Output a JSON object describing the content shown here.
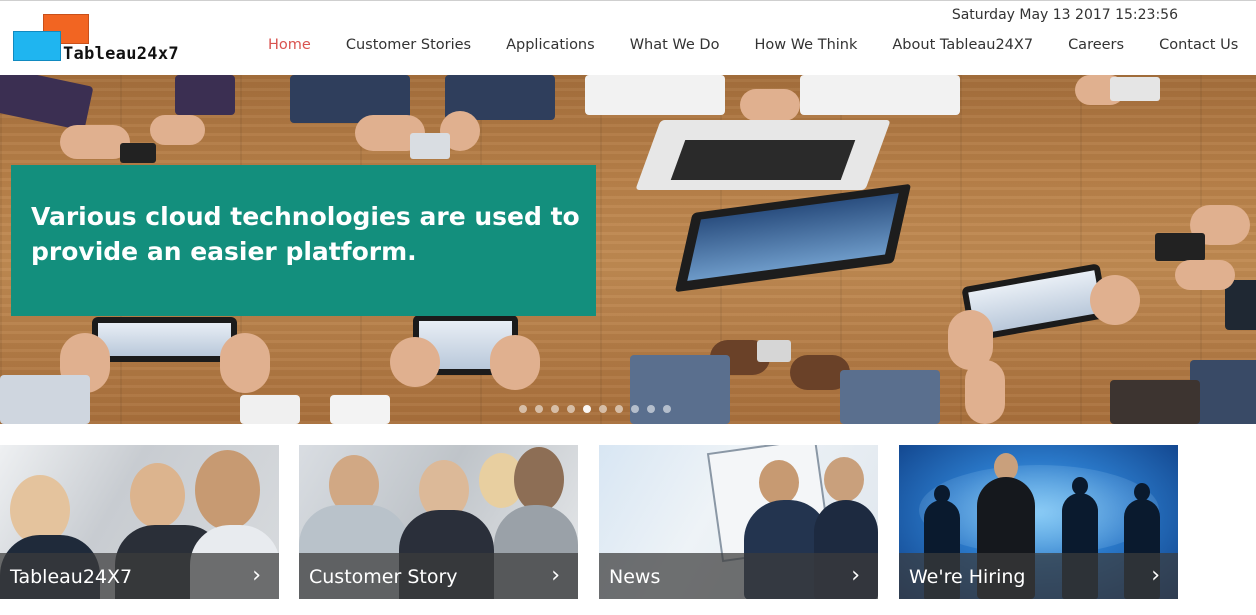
{
  "header": {
    "datetime": "Saturday May 13 2017 15:23:56",
    "logo_text": "Tableau24x7",
    "colors": {
      "logo_orange": "#f26522",
      "logo_blue": "#1fb5f0",
      "nav_active": "#d9534f"
    }
  },
  "nav": {
    "items": [
      {
        "label": "Home",
        "active": true
      },
      {
        "label": "Customer Stories",
        "active": false
      },
      {
        "label": "Applications",
        "active": false
      },
      {
        "label": "What We Do",
        "active": false
      },
      {
        "label": "How We Think",
        "active": false
      },
      {
        "label": "About Tableau24X7",
        "active": false
      },
      {
        "label": "Careers",
        "active": false
      },
      {
        "label": "Contact Us",
        "active": false
      }
    ]
  },
  "hero": {
    "caption": "Various cloud technologies are used to provide an easier platform.",
    "caption_bg": "#138f7d",
    "slide_count": 10,
    "active_slide": 4
  },
  "cards": [
    {
      "label": "Tableau24X7",
      "arrow": "›"
    },
    {
      "label": "Customer Story",
      "arrow": "›"
    },
    {
      "label": "News",
      "arrow": "›"
    },
    {
      "label": "We're Hiring",
      "arrow": "›"
    }
  ]
}
